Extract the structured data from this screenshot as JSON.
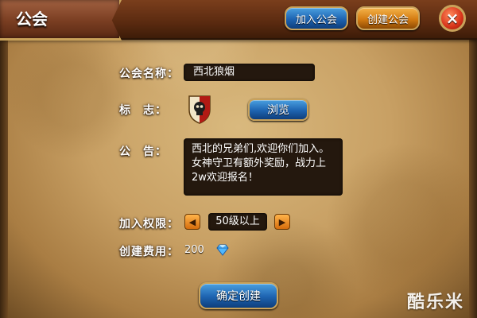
{
  "header": {
    "title": "公会",
    "join_label": "加入公会",
    "create_label": "创建公会",
    "close_glyph": "×"
  },
  "form": {
    "name_label": "公会名称：",
    "name_value": "西北狼烟",
    "emblem_label": "标　志：",
    "emblem_icon": "skull-shield-icon",
    "browse_label": "浏览",
    "notice_label": "公　告：",
    "notice_value": "西北的兄弟们,欢迎你们加入。\n女神守卫有额外奖励，战力上\n2w欢迎报名！",
    "permission_label": "加入权限：",
    "permission_value": "50级以上",
    "cost_label": "创建费用：",
    "cost_value": "200",
    "cost_icon": "diamond-icon"
  },
  "footer": {
    "confirm_label": "确定创建",
    "watermark": "酷乐米"
  },
  "colors": {
    "accent_blue": "#1d63b0",
    "accent_orange": "#d47b12",
    "close_red": "#d8331a",
    "gold_border": "#c9a25a"
  }
}
